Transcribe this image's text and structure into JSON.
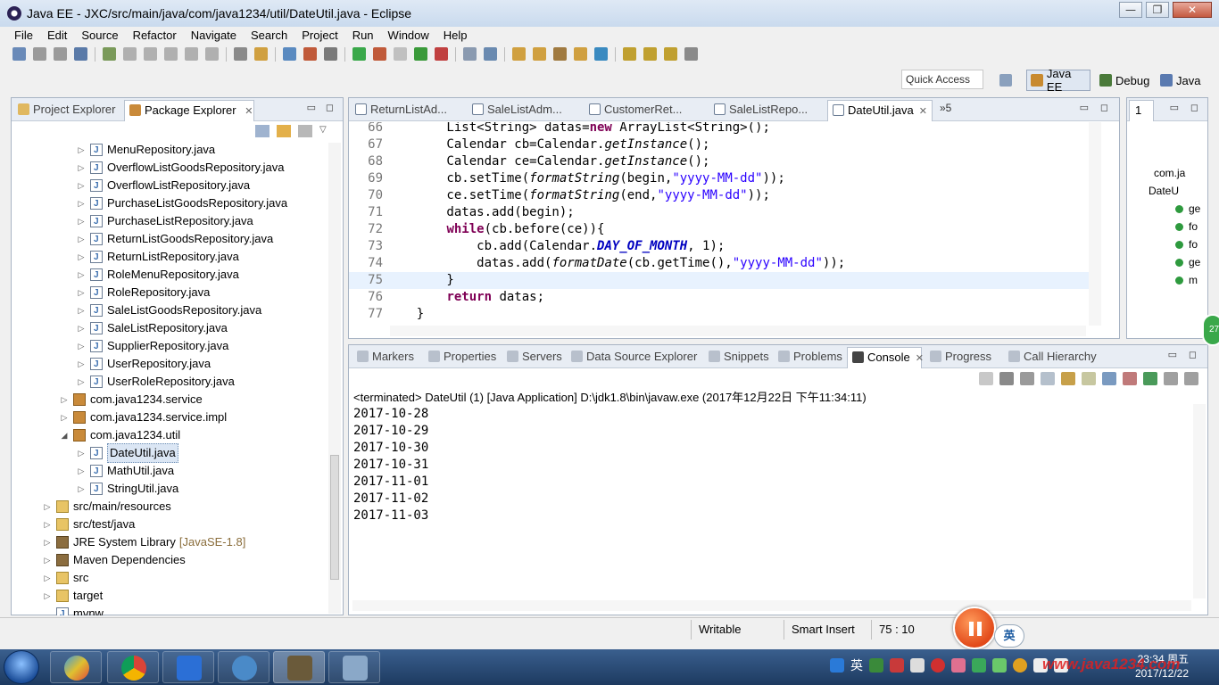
{
  "window": {
    "title": "Java EE - JXC/src/main/java/com/java1234/util/DateUtil.java - Eclipse",
    "controls": {
      "minimize": "—",
      "maximize": "❐",
      "close": "✕"
    }
  },
  "menu": [
    "File",
    "Edit",
    "Source",
    "Refactor",
    "Navigate",
    "Search",
    "Project",
    "Run",
    "Window",
    "Help"
  ],
  "toolbar": {
    "quick_access": "Quick Access",
    "perspectives": {
      "javaee": "Java EE",
      "debug": "Debug",
      "java": "Java"
    }
  },
  "explorer": {
    "tab_inactive": "Project Explorer",
    "tab_active": "Package Explorer",
    "items": [
      {
        "label": "MenuRepository.java",
        "type": "java",
        "indent": 2,
        "arrow": "▷"
      },
      {
        "label": "OverflowListGoodsRepository.java",
        "type": "java",
        "indent": 2,
        "arrow": "▷"
      },
      {
        "label": "OverflowListRepository.java",
        "type": "java",
        "indent": 2,
        "arrow": "▷"
      },
      {
        "label": "PurchaseListGoodsRepository.java",
        "type": "java",
        "indent": 2,
        "arrow": "▷"
      },
      {
        "label": "PurchaseListRepository.java",
        "type": "java",
        "indent": 2,
        "arrow": "▷"
      },
      {
        "label": "ReturnListGoodsRepository.java",
        "type": "java",
        "indent": 2,
        "arrow": "▷"
      },
      {
        "label": "ReturnListRepository.java",
        "type": "java",
        "indent": 2,
        "arrow": "▷"
      },
      {
        "label": "RoleMenuRepository.java",
        "type": "java",
        "indent": 2,
        "arrow": "▷"
      },
      {
        "label": "RoleRepository.java",
        "type": "java",
        "indent": 2,
        "arrow": "▷"
      },
      {
        "label": "SaleListGoodsRepository.java",
        "type": "java",
        "indent": 2,
        "arrow": "▷"
      },
      {
        "label": "SaleListRepository.java",
        "type": "java",
        "indent": 2,
        "arrow": "▷"
      },
      {
        "label": "SupplierRepository.java",
        "type": "java",
        "indent": 2,
        "arrow": "▷"
      },
      {
        "label": "UserRepository.java",
        "type": "java",
        "indent": 2,
        "arrow": "▷"
      },
      {
        "label": "UserRoleRepository.java",
        "type": "java",
        "indent": 2,
        "arrow": "▷"
      },
      {
        "label": "com.java1234.service",
        "type": "pkg",
        "indent": 1,
        "arrow": "▷"
      },
      {
        "label": "com.java1234.service.impl",
        "type": "pkg",
        "indent": 1,
        "arrow": "▷"
      },
      {
        "label": "com.java1234.util",
        "type": "pkg",
        "indent": 1,
        "arrow": "◢"
      },
      {
        "label": "DateUtil.java",
        "type": "java",
        "indent": 2,
        "arrow": "▷",
        "selected": true
      },
      {
        "label": "MathUtil.java",
        "type": "java",
        "indent": 2,
        "arrow": "▷"
      },
      {
        "label": "StringUtil.java",
        "type": "java",
        "indent": 2,
        "arrow": "▷"
      },
      {
        "label": "src/main/resources",
        "type": "folder",
        "indent": 0,
        "arrow": "▷"
      },
      {
        "label": "src/test/java",
        "type": "folder",
        "indent": 0,
        "arrow": "▷"
      },
      {
        "label": "JRE System Library",
        "type": "lib",
        "indent": 0,
        "arrow": "▷",
        "suffix": "[JavaSE-1.8]"
      },
      {
        "label": "Maven Dependencies",
        "type": "lib",
        "indent": 0,
        "arrow": "▷"
      },
      {
        "label": "src",
        "type": "folder",
        "indent": 0,
        "arrow": "▷"
      },
      {
        "label": "target",
        "type": "folder",
        "indent": 0,
        "arrow": "▷"
      },
      {
        "label": "mvnw",
        "type": "java",
        "indent": 0,
        "arrow": ""
      }
    ]
  },
  "editor": {
    "tabs": [
      {
        "label": "ReturnListAd..."
      },
      {
        "label": "SaleListAdm..."
      },
      {
        "label": "CustomerRet..."
      },
      {
        "label": "SaleListRepo..."
      },
      {
        "label": "DateUtil.java",
        "active": true
      }
    ],
    "overflow_tab": "»5",
    "lines": [
      {
        "n": "66",
        "html": "        List&lt;String&gt; datas=<span class=\"kw\">new</span> ArrayList&lt;String&gt;();"
      },
      {
        "n": "67",
        "html": "        Calendar cb=Calendar.<span class=\"itl\">getInstance</span>();"
      },
      {
        "n": "68",
        "html": "        Calendar ce=Calendar.<span class=\"itl\">getInstance</span>();"
      },
      {
        "n": "69",
        "html": "        cb.setTime(<span class=\"itl\">formatString</span>(begin,<span class=\"str\">\"yyyy-MM-dd\"</span>));"
      },
      {
        "n": "70",
        "html": "        ce.setTime(<span class=\"itl\">formatString</span>(end,<span class=\"str\">\"yyyy-MM-dd\"</span>));"
      },
      {
        "n": "71",
        "html": "        datas.add(begin);"
      },
      {
        "n": "72",
        "html": "        <span class=\"kw\">while</span>(cb.before(ce)){"
      },
      {
        "n": "73",
        "html": "            cb.add(Calendar.<span class=\"cst\">DAY_OF_MONTH</span>, 1);"
      },
      {
        "n": "74",
        "html": "            datas.add(<span class=\"itl\">formatDate</span>(cb.getTime(),<span class=\"str\">\"yyyy-MM-dd\"</span>));"
      },
      {
        "n": "75",
        "html": "        }",
        "current": true
      },
      {
        "n": "76",
        "html": "        <span class=\"kw\">return</span> datas;"
      },
      {
        "n": "77",
        "html": "    }"
      }
    ]
  },
  "outline": {
    "tab": "1",
    "items": [
      {
        "label": "com.ja"
      },
      {
        "label": "DateU"
      },
      {
        "label": "ge"
      },
      {
        "label": "fo"
      },
      {
        "label": "fo"
      },
      {
        "label": "ge"
      },
      {
        "label": "m"
      }
    ]
  },
  "console": {
    "tabs": [
      "Markers",
      "Properties",
      "Servers",
      "Data Source Explorer",
      "Snippets",
      "Problems",
      "Console",
      "Progress",
      "Call Hierarchy"
    ],
    "active_tab": "Console",
    "terminated": "<terminated> DateUtil (1) [Java Application] D:\\jdk1.8\\bin\\javaw.exe (2017年12月22日 下午11:34:11)",
    "output": [
      "2017-10-28",
      "2017-10-29",
      "2017-10-30",
      "2017-10-31",
      "2017-11-01",
      "2017-11-02",
      "2017-11-03"
    ]
  },
  "status": {
    "mode": "Writable",
    "insert": "Smart Insert",
    "position": "75 : 10"
  },
  "overlay": {
    "ime_badge": "英",
    "bubble": "27"
  },
  "taskbar": {
    "ime": "英",
    "time": "23:34 周五",
    "date": "2017/12/22",
    "watermark": "www.java1234.com"
  },
  "colors": {
    "keyword": "#7f0055",
    "string": "#2a00ff",
    "constant": "#0000c0",
    "current_line": "#e8f2fe"
  }
}
